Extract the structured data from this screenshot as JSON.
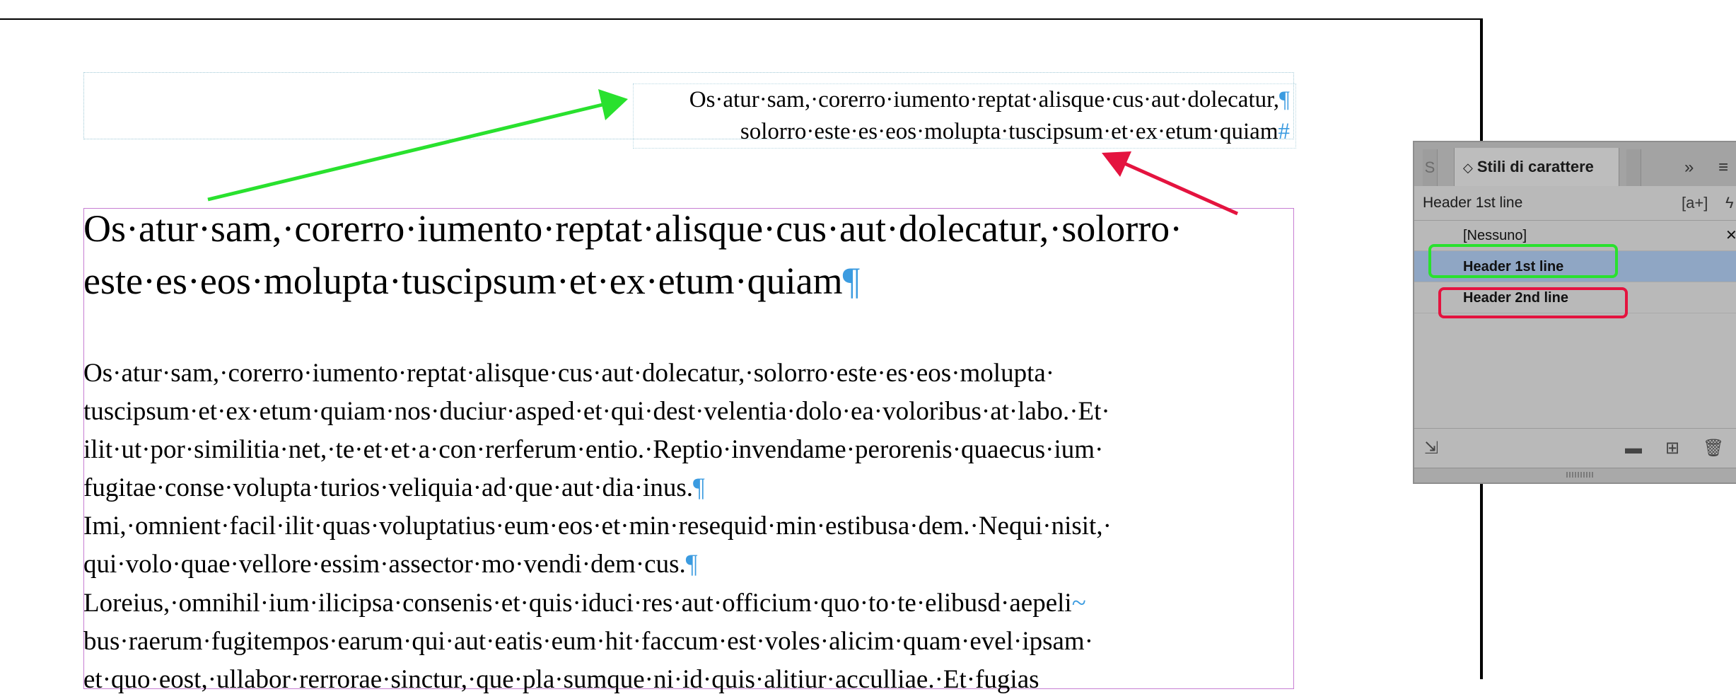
{
  "document": {
    "header_lines": [
      "Os·atur·sam,·corerro·iumento·reptat·alisque·cus·aut·dolecatur,",
      "solorro·este·es·eos·molupta·tuscipsum·et·ex·etum·quiam"
    ],
    "header_line_marks": [
      "¶",
      "#"
    ],
    "heading_lines": [
      "Os·atur·sam,·corerro·iumento·reptat·alisque·cus·aut·dolecatur,·solorro·",
      "este·es·eos·molupta·tuscipsum·et·ex·etum·quiam"
    ],
    "heading_mark": "¶",
    "paragraphs": [
      {
        "lines": [
          "Os·atur·sam,·corerro·iumento·reptat·alisque·cus·aut·dolecatur,·solorro·este·es·eos·molupta·",
          "tuscipsum·et·ex·etum·quiam·nos·duciur·asped·et·qui·dest·velentia·dolo·ea·voloribus·at·labo.·Et·",
          "ilit·ut·por·similitia·net,·te·et·et·a·con·rerferum·entio.·Reptio·invendame·perorenis·quaecus·ium·",
          "fugitae·conse·volupta·turios·veliquia·ad·que·aut·dia·inus."
        ],
        "mark": "¶"
      },
      {
        "lines": [
          "Imi,·omnient·facil·ilit·quas·voluptatius·eum·eos·et·min·resequid·min·estibusa·dem.·Nequi·nisit,·",
          "qui·volo·quae·vellore·essim·assector·mo·vendi·dem·cus."
        ],
        "mark": "¶"
      },
      {
        "lines": [
          "Loreius,·omnihil·ium·ilicipsa·consenis·et·quis·iduci·res·aut·officium·quo·to·te·elibusd·aepeli",
          "bus·raerum·fugitempos·earum·qui·aut·eatis·eum·hit·faccum·est·voles·alicim·quam·evel·ipsam·",
          "et·quo·eost,·ullabor·rerrorae·sinctur,·que·pla·sumque·ni·id·quis·alitiur·acculliae.·Et·fugias"
        ],
        "hyphen_mark": "~",
        "mark": ""
      }
    ]
  },
  "panel": {
    "tab_stub_left": "S",
    "tab_title": "Stili di carattere",
    "tab_chevron": "◇",
    "tab_more": "»",
    "menu_icon": "≡",
    "current_style": "Header 1st line",
    "quick_apply_icon": "[a+]",
    "lightning_icon": "ϟ",
    "styles": [
      {
        "label": "[Nessuno]"
      },
      {
        "label": "Header 1st line"
      },
      {
        "label": "Header 2nd line"
      }
    ],
    "colors": {
      "selected_row": "#8fa6c4",
      "green_highlight": "#29e12e",
      "red_highlight": "#e4133f"
    }
  }
}
